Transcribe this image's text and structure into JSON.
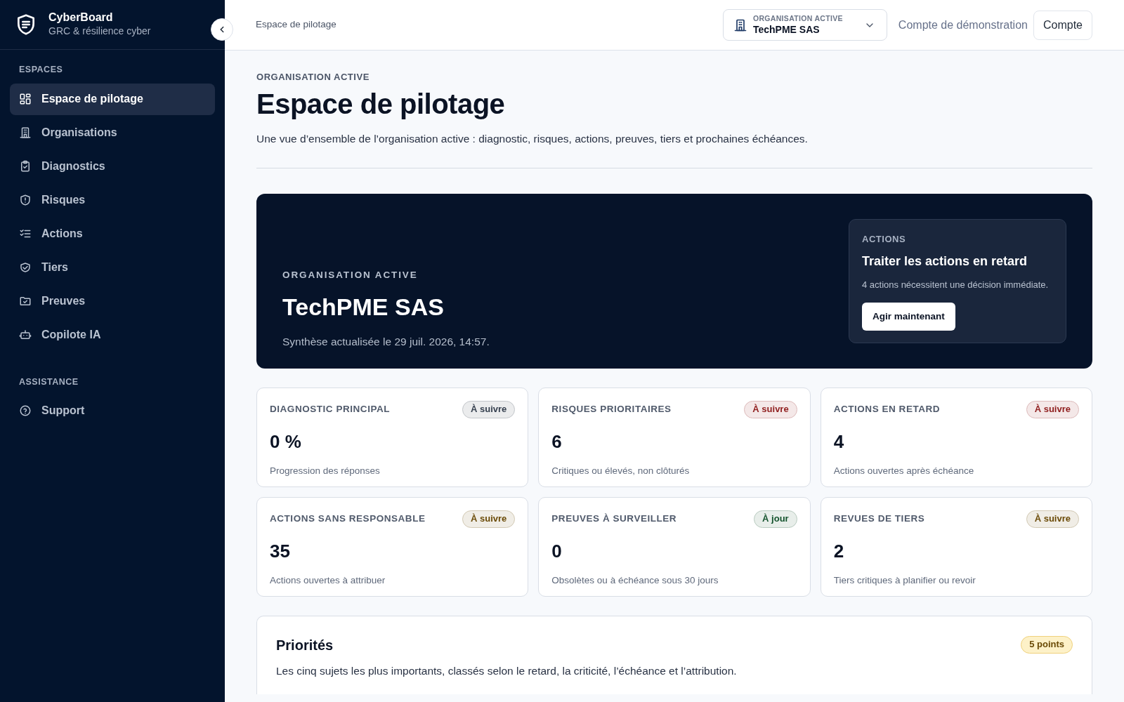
{
  "brand": {
    "name": "CyberBoard",
    "tagline": "GRC & résilience cyber"
  },
  "sidebar": {
    "sections": [
      {
        "title": "ESPACES",
        "items": [
          {
            "label": "Espace de pilotage",
            "selected": true
          },
          {
            "label": "Organisations",
            "selected": false
          },
          {
            "label": "Diagnostics",
            "selected": false
          },
          {
            "label": "Risques",
            "selected": false
          },
          {
            "label": "Actions",
            "selected": false
          },
          {
            "label": "Tiers",
            "selected": false
          },
          {
            "label": "Preuves",
            "selected": false
          },
          {
            "label": "Copilote IA",
            "selected": false
          }
        ]
      },
      {
        "title": "ASSISTANCE",
        "items": [
          {
            "label": "Support",
            "selected": false
          }
        ]
      }
    ]
  },
  "topbar": {
    "breadcrumb": "Espace de pilotage",
    "org_selector": {
      "label": "ORGANISATION ACTIVE",
      "value": "TechPME SAS"
    },
    "account_name": "Compte de démonstration",
    "account_button": "Compte"
  },
  "header": {
    "eyebrow": "ORGANISATION ACTIVE",
    "title": "Espace de pilotage",
    "subtitle": "Une vue d’ensemble de l’organisation active : diagnostic, risques, actions, preuves, tiers et prochaines échéances."
  },
  "hero": {
    "eyebrow": "ORGANISATION ACTIVE",
    "title": "TechPME SAS",
    "updated": "Synthèse actualisée le 29 juil. 2026, 14:57.",
    "callout": {
      "eyebrow": "ACTIONS",
      "title": "Traiter les actions en retard",
      "text": "4 actions nécessitent une décision immédiate.",
      "button": "Agir maintenant"
    }
  },
  "metrics": [
    {
      "title": "DIAGNOSTIC PRINCIPAL",
      "badge": "À suivre",
      "color": "#36404f",
      "value": "0 %",
      "caption": "Progression des réponses"
    },
    {
      "title": "RISQUES PRIORITAIRES",
      "badge": "À suivre",
      "color": "#8f1d1d",
      "value": "6",
      "caption": "Critiques ou élevés, non clôturés"
    },
    {
      "title": "ACTIONS EN RETARD",
      "badge": "À suivre",
      "color": "#8f1d1d",
      "value": "4",
      "caption": "Actions ouvertes après échéance"
    },
    {
      "title": "ACTIONS SANS RESPONSABLE",
      "badge": "À suivre",
      "color": "#6a4a06",
      "value": "35",
      "caption": "Actions ouvertes à attribuer"
    },
    {
      "title": "PREUVES À SURVEILLER",
      "badge": "À jour",
      "color": "#14532d",
      "value": "0",
      "caption": "Obsolètes ou à échéance sous 30 jours"
    },
    {
      "title": "REVUES DE TIERS",
      "badge": "À suivre",
      "color": "#6a4a06",
      "value": "2",
      "caption": "Tiers critiques à planifier ou revoir"
    }
  ],
  "priorities": {
    "title": "Priorités",
    "badge": "5 points",
    "subtitle": "Les cinq sujets les plus importants, classés selon le retard, la criticité, l’échéance et l’attribution."
  }
}
